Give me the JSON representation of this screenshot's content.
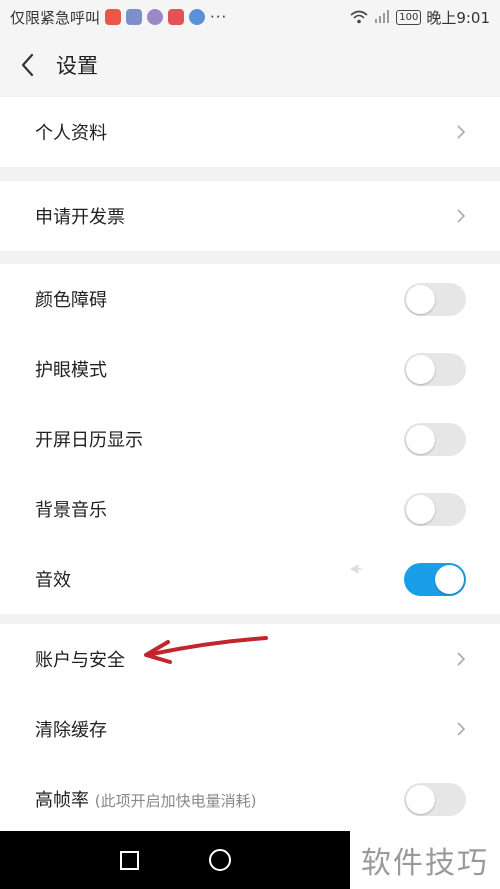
{
  "status_bar": {
    "carrier": "仅限紧急呼叫",
    "more": "···",
    "battery": "100",
    "time": "晚上9:01",
    "notification_icons": [
      "app-notification-icon",
      "app-notification-icon",
      "app-notification-icon",
      "app-notification-icon",
      "app-notification-icon"
    ]
  },
  "header": {
    "title": "设置",
    "back_icon": "chevron-left-icon"
  },
  "groups": [
    {
      "items": [
        {
          "label": "个人资料",
          "control": "chevron"
        }
      ]
    },
    {
      "items": [
        {
          "label": "申请开发票",
          "control": "chevron"
        }
      ]
    },
    {
      "items": [
        {
          "label": "颜色障碍",
          "control": "toggle",
          "on": false
        },
        {
          "label": "护眼模式",
          "control": "toggle",
          "on": false
        },
        {
          "label": "开屏日历显示",
          "control": "toggle",
          "on": false
        },
        {
          "label": "背景音乐",
          "control": "toggle",
          "on": false
        },
        {
          "label": "音效",
          "control": "toggle",
          "on": true
        }
      ]
    },
    {
      "items": [
        {
          "label": "账户与安全",
          "control": "chevron"
        },
        {
          "label": "清除缓存",
          "control": "chevron"
        },
        {
          "label": "高帧率",
          "sublabel": "(此项开启加快电量消耗)",
          "control": "toggle",
          "on": false
        }
      ]
    }
  ],
  "colors": {
    "toggle_on": "#1a9ee8",
    "toggle_off": "#e6e6e6",
    "annotation_arrow": "#c0262b"
  },
  "annotation": {
    "type": "red-arrow",
    "points_to": "账户与安全"
  },
  "nav_bar": {
    "icons": [
      "recent-apps-square-icon",
      "home-circle-icon"
    ]
  },
  "watermark": "软件技巧"
}
